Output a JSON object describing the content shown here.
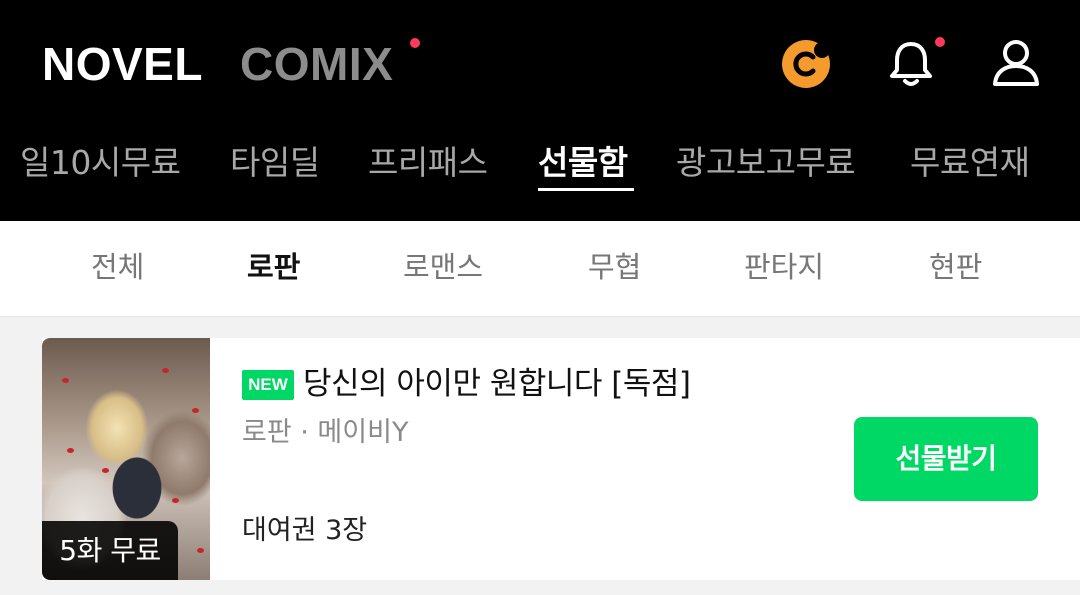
{
  "header": {
    "brand_primary": "NOVEL",
    "brand_secondary": "COMIX",
    "icons": [
      "coin-icon",
      "bell-icon",
      "user-icon"
    ],
    "accent_color": "#ff3b5c"
  },
  "top_tabs": [
    {
      "label": "일10시무료",
      "active": false
    },
    {
      "label": "타임딜",
      "active": false
    },
    {
      "label": "프리패스",
      "active": false
    },
    {
      "label": "선물함",
      "active": true
    },
    {
      "label": "광고보고무료",
      "active": false
    },
    {
      "label": "무료연재",
      "active": false
    }
  ],
  "sub_tabs": [
    {
      "label": "전체",
      "active": false
    },
    {
      "label": "로판",
      "active": true
    },
    {
      "label": "로맨스",
      "active": false
    },
    {
      "label": "무협",
      "active": false
    },
    {
      "label": "판타지",
      "active": false
    },
    {
      "label": "현판",
      "active": false
    }
  ],
  "item": {
    "new_badge": "NEW",
    "title": "당신의 아이만 원합니다 [독점]",
    "meta": "로판 · 메이비Y",
    "rental": "대여권 3장",
    "free_badge": "5화 무료",
    "button_label": "선물받기",
    "button_color": "#00d865"
  }
}
